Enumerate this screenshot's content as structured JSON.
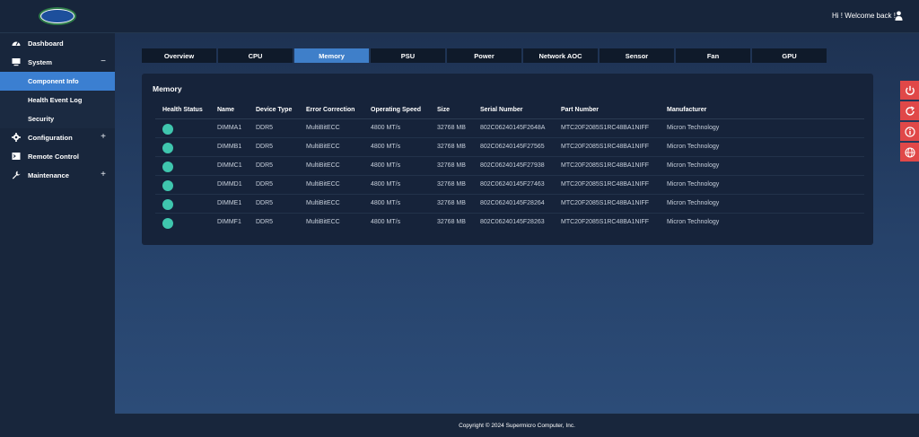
{
  "header": {
    "welcome_text": "Hi ! Welcome back !"
  },
  "sidebar": {
    "items": [
      {
        "label": "Dashboard",
        "icon": "gauge-icon",
        "toggle": ""
      },
      {
        "label": "System",
        "icon": "monitor-icon",
        "toggle": "−"
      },
      {
        "label": "Configuration",
        "icon": "gear-icon",
        "toggle": "+"
      },
      {
        "label": "Remote Control",
        "icon": "terminal-icon",
        "toggle": ""
      },
      {
        "label": "Maintenance",
        "icon": "wrench-icon",
        "toggle": "+"
      }
    ],
    "system_sub": [
      {
        "label": "Component Info",
        "active": true
      },
      {
        "label": "Health Event Log",
        "active": false
      },
      {
        "label": "Security",
        "active": false
      }
    ]
  },
  "tabs": [
    {
      "label": "Overview",
      "active": false
    },
    {
      "label": "CPU",
      "active": false
    },
    {
      "label": "Memory",
      "active": true
    },
    {
      "label": "PSU",
      "active": false
    },
    {
      "label": "Power",
      "active": false
    },
    {
      "label": "Network AOC",
      "active": false
    },
    {
      "label": "Sensor",
      "active": false
    },
    {
      "label": "Fan",
      "active": false
    },
    {
      "label": "GPU",
      "active": false
    }
  ],
  "panel": {
    "title": "Memory",
    "columns": [
      "Health Status",
      "Name",
      "Device Type",
      "Error Correction",
      "Operating Speed",
      "Size",
      "Serial Number",
      "Part Number",
      "Manufacturer"
    ],
    "rows": [
      [
        "DIMMA1",
        "DDR5",
        "MultiBitECC",
        "4800 MT/s",
        "32768 MB",
        "802C06240145F2648A",
        "MTC20F2085S1RC48BA1NIFF",
        "Micron Technology"
      ],
      [
        "DIMMB1",
        "DDR5",
        "MultiBitECC",
        "4800 MT/s",
        "32768 MB",
        "802C06240145F27565",
        "MTC20F2085S1RC48BA1NIFF",
        "Micron Technology"
      ],
      [
        "DIMMC1",
        "DDR5",
        "MultiBitECC",
        "4800 MT/s",
        "32768 MB",
        "802C06240145F27938",
        "MTC20F2085S1RC48BA1NIFF",
        "Micron Technology"
      ],
      [
        "DIMMD1",
        "DDR5",
        "MultiBitECC",
        "4800 MT/s",
        "32768 MB",
        "802C06240145F27463",
        "MTC20F2085S1RC48BA1NIFF",
        "Micron Technology"
      ],
      [
        "DIMME1",
        "DDR5",
        "MultiBitECC",
        "4800 MT/s",
        "32768 MB",
        "802C06240145F28264",
        "MTC20F2085S1RC48BA1NIFF",
        "Micron Technology"
      ],
      [
        "DIMMF1",
        "DDR5",
        "MultiBitECC",
        "4800 MT/s",
        "32768 MB",
        "802C06240145F28263",
        "MTC20F2085S1RC48BA1NIFF",
        "Micron Technology"
      ]
    ],
    "status_color": "#3fc6ae"
  },
  "side_buttons": [
    "power-icon",
    "refresh-icon",
    "info-icon",
    "globe-icon"
  ],
  "footer": {
    "copyright": "Copyright © 2024 Supermicro Computer, Inc."
  },
  "colors": {
    "accent": "#3b7fd1",
    "alert": "#e04848"
  }
}
